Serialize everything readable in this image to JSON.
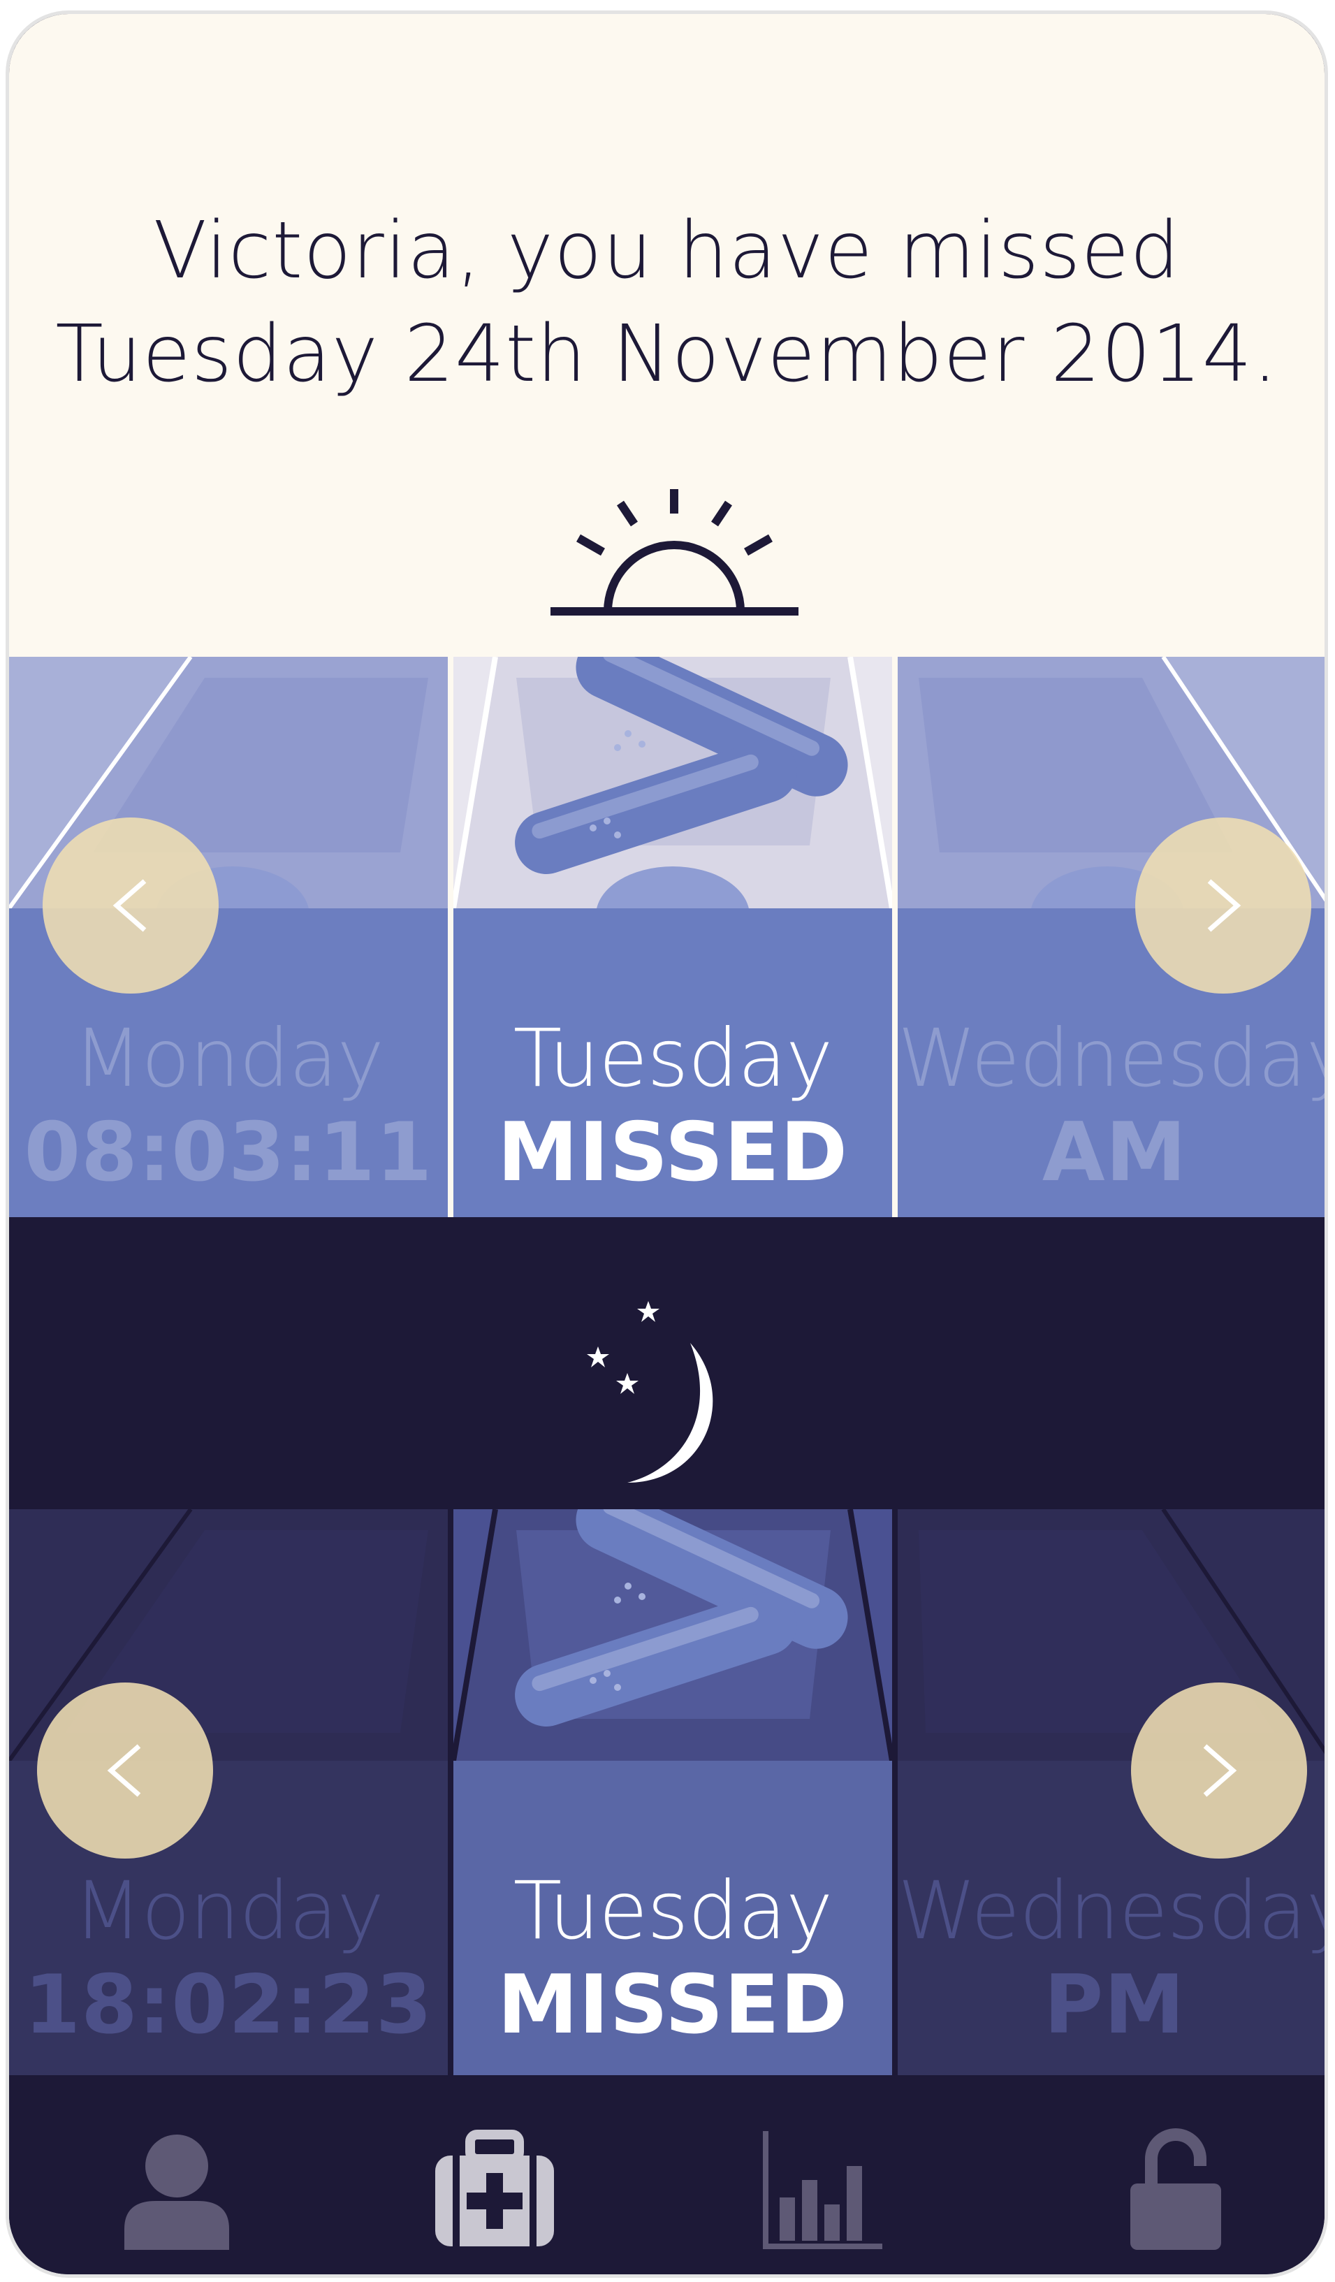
{
  "message": {
    "line1": "Victoria, you have missed",
    "line2": "Tuesday 24th November 2014."
  },
  "morning": {
    "icon": "sunrise-icon",
    "compartments": [
      {
        "day": "Monday",
        "status": "08:03:11"
      },
      {
        "day": "Tuesday",
        "status": "MISSED"
      },
      {
        "day": "Wednesday",
        "status": "AM"
      }
    ]
  },
  "evening": {
    "icon": "moon-stars-icon",
    "compartments": [
      {
        "day": "Monday",
        "status": "18:02:23"
      },
      {
        "day": "Tuesday",
        "status": "MISSED"
      },
      {
        "day": "Wednesday",
        "status": "PM"
      }
    ]
  },
  "tabbar": {
    "tabs": [
      {
        "icon": "user-icon",
        "active": false
      },
      {
        "icon": "medical-kit-icon",
        "active": true
      },
      {
        "icon": "bar-chart-icon",
        "active": false
      },
      {
        "icon": "unlock-icon",
        "active": false
      }
    ]
  },
  "colors": {
    "navy": "#1d1937",
    "cream": "#fdf9f0",
    "pill_blue": "#6a7dc0",
    "nav_button": "#efdeb2",
    "tab_inactive": "#5e5975",
    "tab_active": "#c9c7d1"
  }
}
